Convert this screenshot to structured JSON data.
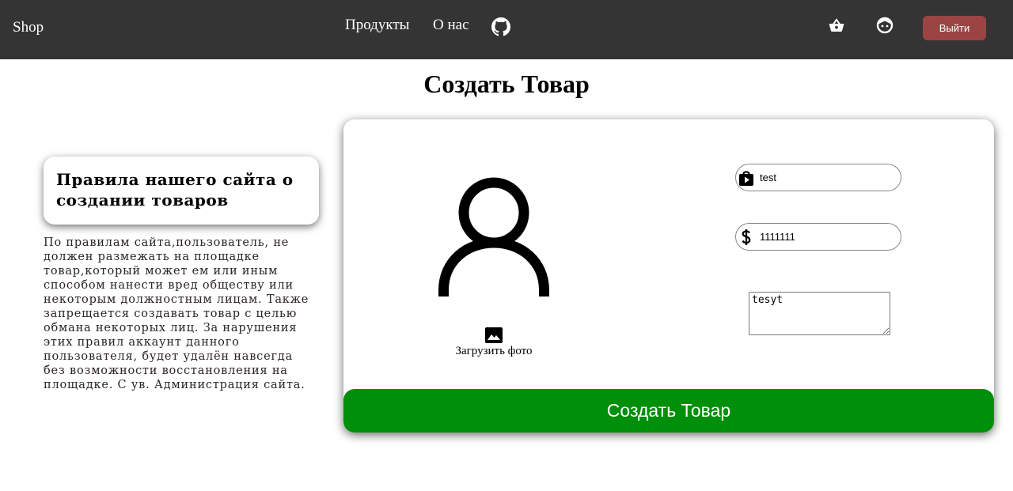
{
  "navbar": {
    "brand": "Shop",
    "links": [
      "Продукты",
      "О нас"
    ],
    "icons": {
      "github": "github-icon",
      "basket": "basket-icon",
      "profile": "face-icon"
    },
    "logout_label": "Выйти",
    "colors": {
      "background": "#343434",
      "logout": "#9a4444"
    }
  },
  "page": {
    "title": "Создать Товар"
  },
  "rules": {
    "title": "Правила нашего сайта о создании товаров",
    "text": "По правилам сайта,пользователь, не должен размежать на площадке товар,который может ем или иным способом нанести вред обществу или некоторым должностным лицам. Также запрещается создавать товар с целью обмана некоторых лиц. За нарушения этих правил аккаунт данного пользователя, будет удалён навсегда без возможности восстановления на площадке. С ув. Администрация сайта."
  },
  "form": {
    "avatar_icon": "user-avatar-icon",
    "upload_icon": "image-icon",
    "upload_label": "Загрузить фото",
    "name_value": "test",
    "name_icon": "shop-bag-icon",
    "price_value": "1111111",
    "price_icon": "dollar-icon",
    "description_value": "tesyt",
    "submit_label": "Создать Товар",
    "colors": {
      "submit": "#008f0a"
    }
  }
}
